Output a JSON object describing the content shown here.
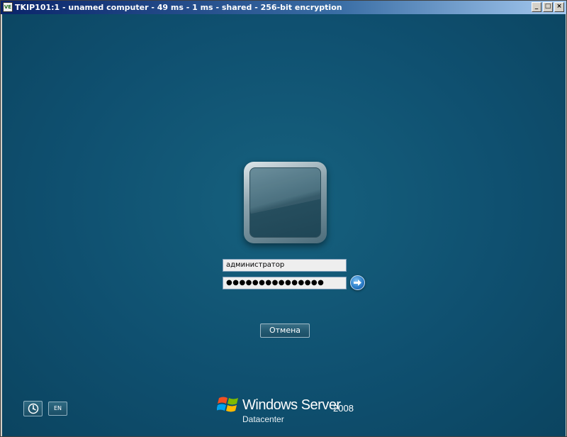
{
  "window": {
    "title": "TKIP101:1 - unamed computer - 49 ms - 1 ms - shared - 256-bit encryption",
    "app_icon_label": "VE",
    "controls": {
      "minimize": "_",
      "maximize": "□",
      "close": "×"
    }
  },
  "login": {
    "username_value": "администратор",
    "password_value": "●●●●●●●●●●●●●●●",
    "cancel_label": "Отмена"
  },
  "footer": {
    "language_label": "EN",
    "brand_name": "Windows Server",
    "brand_version": "2008",
    "brand_edition": "Datacenter"
  },
  "colors": {
    "background": "#0d4b66",
    "title_bar": "#0a246a",
    "go_button": "#2d7fc9"
  }
}
